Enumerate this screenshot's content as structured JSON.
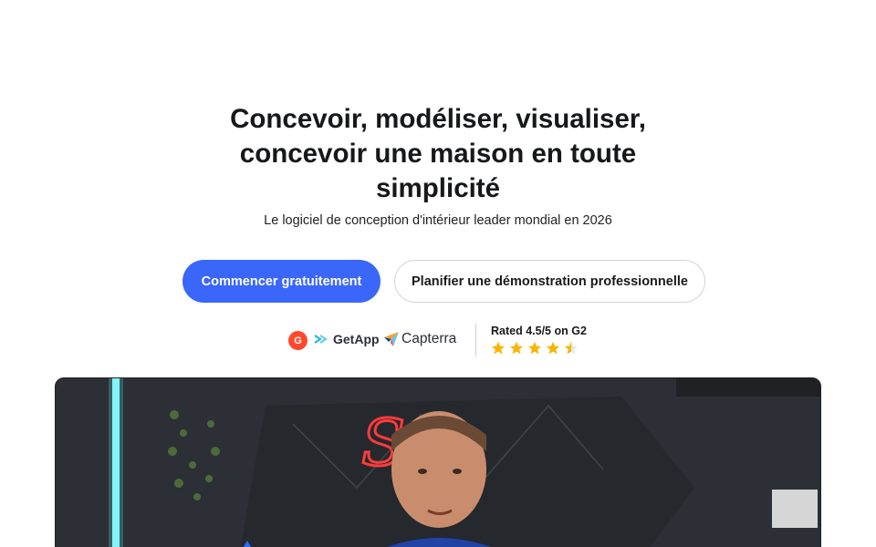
{
  "hero": {
    "title_lines": [
      "Concevoir, modéliser, visualiser,",
      "concevoir une maison en toute",
      "simplicité"
    ],
    "subtitle": "Le logiciel de conception d'intérieur leader mondial en 2026"
  },
  "cta": {
    "primary_label": "Commencer gratuitement",
    "secondary_label": "Planifier une démonstration professionnelle",
    "primary_color": "#3a66f9"
  },
  "reviews": {
    "logos": [
      "g2-icon",
      "getapp-icon",
      "capterra-icon"
    ],
    "g2_letter": "G",
    "getapp_label": "GetApp",
    "capterra_label": "Capterra",
    "rating_text": "Rated 4.5/5 on G2",
    "rating": 4.5,
    "star_color": "#f7b500"
  },
  "video": {
    "neon_text": "Ss",
    "subject": "presenter-video"
  }
}
